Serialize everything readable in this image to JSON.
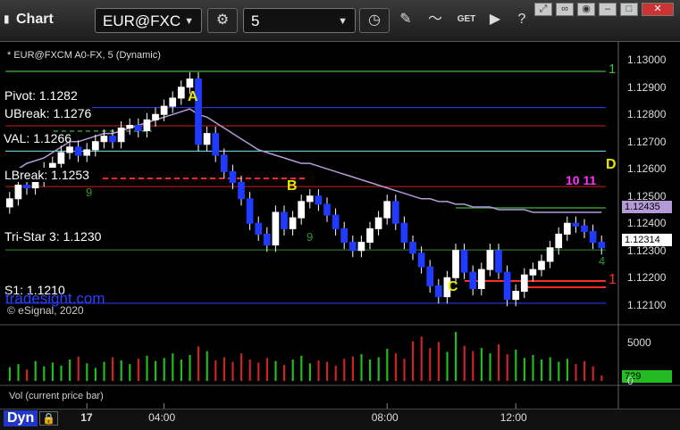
{
  "toolbar": {
    "title": "Chart",
    "symbol": "EUR@FXC",
    "interval": "5",
    "get_label": "GET"
  },
  "chart": {
    "study_title": "* EUR@FXCM A0-FX, 5 (Dynamic)",
    "copyright": "© eSignal, 2020",
    "watermark": "tradesight.com",
    "volume_title": "Vol (current price bar)",
    "dyn_label": "Dyn",
    "last_price": "1.12314",
    "ma_price": "1.12435",
    "last_volume": "729"
  },
  "levels": [
    {
      "label": "Pivot: 1.1282",
      "price": 1.12825,
      "color": "#2a3fff"
    },
    {
      "label": "UBreak: 1.1276",
      "price": 1.12758,
      "color": "#cc2222"
    },
    {
      "label": "VAL: 1.1266",
      "price": 1.12665,
      "color": "#7ee8f0"
    },
    {
      "label": "LBreak: 1.1253",
      "price": 1.12535,
      "color": "#cc2222"
    },
    {
      "label": "Tri-Star 3: 1.1230",
      "price": 1.12302,
      "color": "#2e8b2e"
    },
    {
      "label": "S1: 1.1210",
      "price": 1.12106,
      "color": "#2a3fff"
    }
  ],
  "markers": [
    "A",
    "B",
    "C",
    "D"
  ],
  "counts": {
    "top_green": "1",
    "red": "1",
    "magenta": "10 11",
    "seq_a": "9",
    "seq_b": "9",
    "seq_c": "4"
  },
  "chart_data": {
    "type": "candlestick",
    "series": [
      {
        "name": "EUR@FXCM A0-FX, 5",
        "close": [
          1.1249,
          1.1254,
          1.1253,
          1.1256,
          1.126,
          1.1262,
          1.1266,
          1.1268,
          1.1265,
          1.1267,
          1.127,
          1.1272,
          1.127,
          1.1275,
          1.1276,
          1.1274,
          1.1278,
          1.128,
          1.1283,
          1.1286,
          1.129,
          1.1293,
          1.1269,
          1.1273,
          1.1265,
          1.1259,
          1.1255,
          1.1249,
          1.124,
          1.1236,
          1.1232,
          1.1244,
          1.1238,
          1.1242,
          1.1248,
          1.125,
          1.1247,
          1.1243,
          1.1238,
          1.1233,
          1.123,
          1.1233,
          1.1238,
          1.1242,
          1.1248,
          1.124,
          1.1233,
          1.1229,
          1.1224,
          1.1217,
          1.1213,
          1.122,
          1.123,
          1.1222,
          1.1216,
          1.1223,
          1.123,
          1.1222,
          1.1212,
          1.1215,
          1.1221,
          1.1223,
          1.1226,
          1.1231,
          1.1236,
          1.124,
          1.1239,
          1.1237,
          1.1233,
          1.1231
        ]
      },
      {
        "name": "Moving average",
        "values": [
          1.1259,
          1.126,
          1.1262,
          1.1263,
          1.1264,
          1.1266,
          1.1268,
          1.127,
          1.127,
          1.1271,
          1.1272,
          1.1273,
          1.1273,
          1.1274,
          1.1275,
          1.1276,
          1.1277,
          1.1278,
          1.1279,
          1.128,
          1.1281,
          1.1282,
          1.128,
          1.1279,
          1.1277,
          1.1275,
          1.1273,
          1.1271,
          1.1269,
          1.1267,
          1.1266,
          1.1265,
          1.1264,
          1.1263,
          1.1262,
          1.1262,
          1.1261,
          1.126,
          1.1259,
          1.1258,
          1.1257,
          1.1256,
          1.1255,
          1.1254,
          1.1253,
          1.1252,
          1.1251,
          1.125,
          1.1249,
          1.1249,
          1.1248,
          1.1248,
          1.1247,
          1.1247,
          1.1246,
          1.1246,
          1.1246,
          1.1245,
          1.1245,
          1.1245,
          1.1245,
          1.1244,
          1.1244,
          1.1244,
          1.1244,
          1.1244,
          1.1244,
          1.1244,
          1.1244,
          1.1244
        ]
      },
      {
        "name": "Vol (current price bar)",
        "values": [
          1800,
          2200,
          1500,
          2600,
          1900,
          2400,
          2000,
          2800,
          3200,
          2300,
          1700,
          2500,
          3100,
          2700,
          2200,
          2900,
          3300,
          2600,
          3000,
          3600,
          2800,
          3400,
          4500,
          3900,
          2700,
          3100,
          2500,
          3600,
          2800,
          2400,
          3000,
          2600,
          2100,
          2800,
          3300,
          2300,
          2700,
          2500,
          2000,
          2900,
          3200,
          3500,
          2800,
          3100,
          4200,
          3600,
          2900,
          5200,
          5800,
          4300,
          5100,
          3800,
          6400,
          4600,
          3900,
          4300,
          3600,
          4800,
          3500,
          4100,
          3000,
          3400,
          2800,
          3100,
          2500,
          2900,
          2200,
          2600,
          1900,
          729
        ]
      }
    ],
    "ylim": [
      1.1205,
      1.1305
    ],
    "y_ticks": [
      "1.13000",
      "1.12900",
      "1.12800",
      "1.12700",
      "1.12600",
      "1.12500",
      "1.12400",
      "1.12300",
      "1.12200",
      "1.12100"
    ],
    "x_ticks": [
      "17",
      "04:00",
      "08:00",
      "12:00"
    ],
    "volume_ticks": [
      "5000",
      "0"
    ],
    "grid": false,
    "legend": "top-left"
  }
}
